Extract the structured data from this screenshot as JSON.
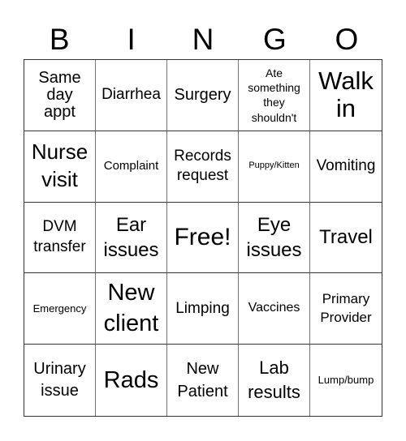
{
  "header": [
    "B",
    "I",
    "N",
    "G",
    "O"
  ],
  "cells": [
    "Same day appt",
    "Diarrhea",
    "Surgery",
    "Ate something they shouldn't",
    "Walk in",
    "Nurse visit",
    "Complaint",
    "Records request",
    "Puppy/Kitten",
    "Vomiting",
    "DVM transfer",
    "Ear issues",
    "Free!",
    "Eye issues",
    "Travel",
    "Emergency",
    "New client",
    "Limping",
    "Vaccines",
    "Primary Provider",
    "Urinary issue",
    "Rads",
    "New Patient",
    "Lab results",
    "Lump/bump"
  ]
}
